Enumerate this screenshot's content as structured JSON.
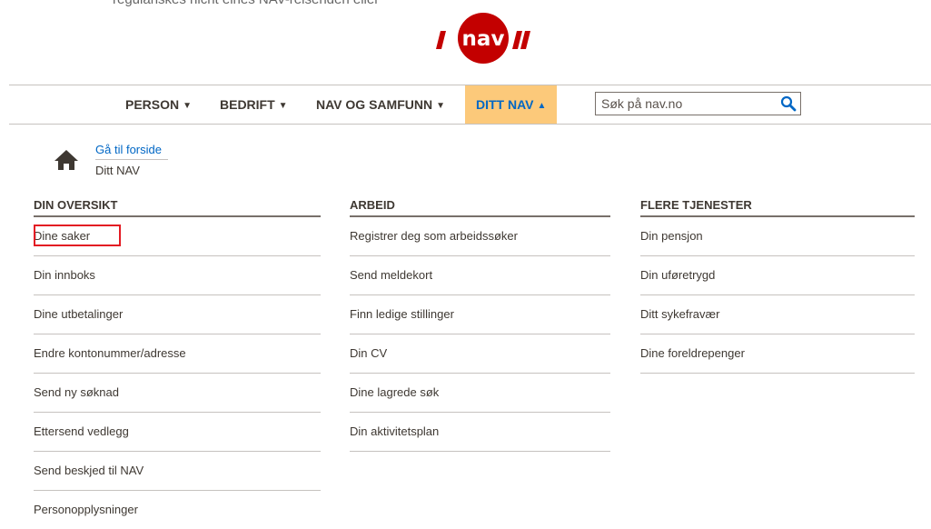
{
  "top_text": "regulariskes nicht eines NAV-reisenden eller",
  "logo": {
    "brand_color": "#c30000",
    "text": "nav"
  },
  "nav": {
    "items": [
      {
        "label": "PERSON"
      },
      {
        "label": "BEDRIFT"
      },
      {
        "label": "NAV OG SAMFUNN"
      },
      {
        "label": "DITT NAV"
      }
    ],
    "active_color": "#fcc97a",
    "search_placeholder": "Søk på nav.no"
  },
  "breadcrumb": {
    "home_link": "Gå til forside",
    "current": "Ditt NAV"
  },
  "columns": [
    {
      "heading": "DIN OVERSIKT",
      "items": [
        "Dine saker",
        "Din innboks",
        "Dine utbetalinger",
        "Endre kontonummer/adresse",
        "Send ny søknad",
        "Ettersend vedlegg",
        "Send beskjed til NAV",
        "Personopplysninger"
      ]
    },
    {
      "heading": "ARBEID",
      "items": [
        "Registrer deg som arbeidssøker",
        "Send meldekort",
        "Finn ledige stillinger",
        "Din CV",
        "Dine lagrede søk",
        "Din aktivitetsplan"
      ]
    },
    {
      "heading": "FLERE TJENESTER",
      "items": [
        "Din pensjon",
        "Din uføretrygd",
        "Ditt sykefravær",
        "Dine foreldrepenger"
      ]
    }
  ],
  "highlight_color": "#e31b23"
}
